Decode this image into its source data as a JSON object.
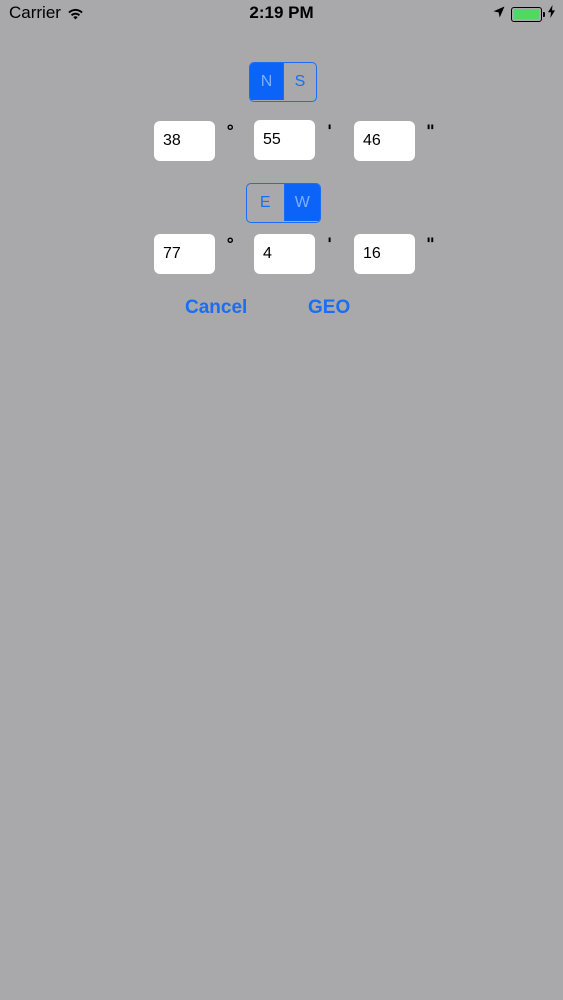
{
  "status_bar": {
    "carrier": "Carrier",
    "time": "2:19 PM",
    "battery_level": 1.0,
    "icons": [
      "wifi-icon",
      "location-arrow-icon",
      "battery-icon",
      "charging-bolt-icon"
    ]
  },
  "latitude": {
    "hemisphere_options": [
      "N",
      "S"
    ],
    "selected_hemisphere": "N",
    "degrees": "38",
    "minutes": "55",
    "seconds": "46"
  },
  "longitude": {
    "hemisphere_options": [
      "E",
      "W"
    ],
    "selected_hemisphere": "W",
    "degrees": "77",
    "minutes": "4",
    "seconds": "16"
  },
  "units": {
    "degree_symbol": "°",
    "minute_symbol": "'",
    "second_symbol": "\""
  },
  "actions": {
    "cancel_label": "Cancel",
    "geo_label": "GEO"
  },
  "colors": {
    "background": "#a9a8ab",
    "accent": "#1a6ef5",
    "segment_selected": "#0b63f8",
    "battery_fill": "#4cd964"
  }
}
